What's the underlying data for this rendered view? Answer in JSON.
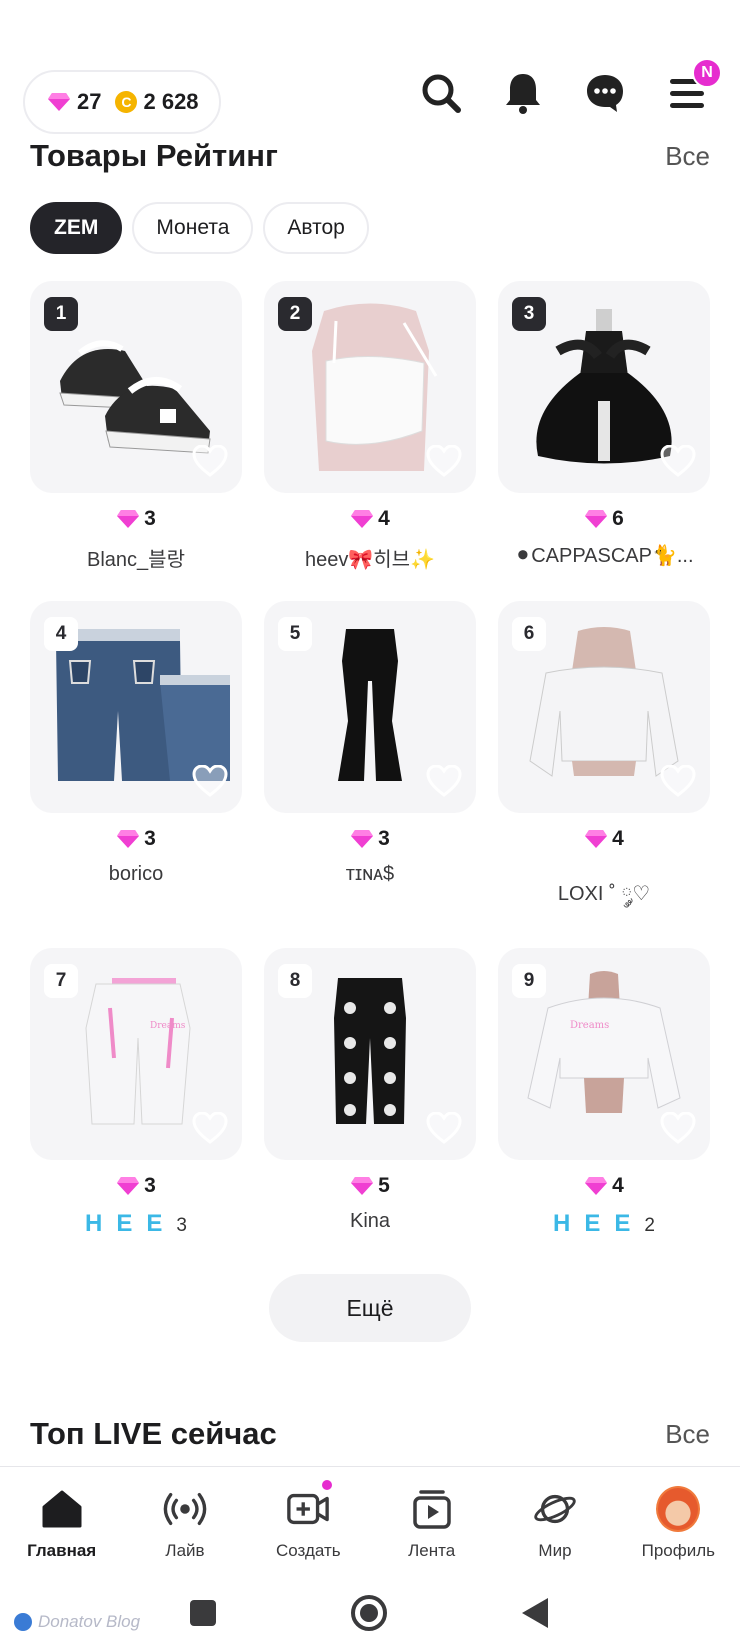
{
  "wallet": {
    "gems": "27",
    "coins": "2 628",
    "coin_symbol": "C"
  },
  "top_icons": [
    "search-icon",
    "bell-icon",
    "chat-icon",
    "menu-icon"
  ],
  "menu_badge": "N",
  "products_section": {
    "title": "Товары Рейтинг",
    "all_link": "Все"
  },
  "filters": [
    {
      "label": "ZEM",
      "active": true
    },
    {
      "label": "Монета",
      "active": false
    },
    {
      "label": "Автор",
      "active": false
    }
  ],
  "items": [
    {
      "rank": "1",
      "price": "3",
      "author": "Blanc_블랑",
      "image": "sneakers"
    },
    {
      "rank": "2",
      "price": "4",
      "author": "heev🎀히브✨",
      "image": "top"
    },
    {
      "rank": "3",
      "price": "6",
      "author": "⚫CAPPASCAP🐈...",
      "image": "dress"
    },
    {
      "rank": "4",
      "price": "3",
      "author": "borico",
      "image": "jeans"
    },
    {
      "rank": "5",
      "price": "3",
      "author": "ᴛɪɴᴀ$",
      "image": "flares"
    },
    {
      "rank": "6",
      "price": "4",
      "author": "LOXI ˚ ༘♡",
      "image": "blouse"
    },
    {
      "rank": "7",
      "price": "3",
      "author_hee": "HEE",
      "author_sub": "3",
      "image": "sweatpants"
    },
    {
      "rank": "8",
      "price": "5",
      "author": "Kina",
      "image": "skullpants"
    },
    {
      "rank": "9",
      "price": "4",
      "author_hee": "HEE",
      "author_sub": "2",
      "image": "hoodie"
    }
  ],
  "more_button": "Ещё",
  "live_section": {
    "title": "Топ LIVE сейчас",
    "all_link": "Все"
  },
  "bottom_nav": [
    {
      "label": "Главная",
      "icon": "home-icon",
      "active": true
    },
    {
      "label": "Лайв",
      "icon": "live-icon",
      "active": false
    },
    {
      "label": "Создать",
      "icon": "create-icon",
      "active": false
    },
    {
      "label": "Лента",
      "icon": "feed-icon",
      "active": false
    },
    {
      "label": "Мир",
      "icon": "planet-icon",
      "active": false
    },
    {
      "label": "Профиль",
      "icon": "avatar",
      "active": false
    }
  ],
  "watermark": "Donatov Blog",
  "colors": {
    "accent_pink": "#e62ccf",
    "gem": "#f03fd2",
    "coin": "#f5b400",
    "hee_blue": "#3bb8e6",
    "chip_active": "#242429"
  }
}
